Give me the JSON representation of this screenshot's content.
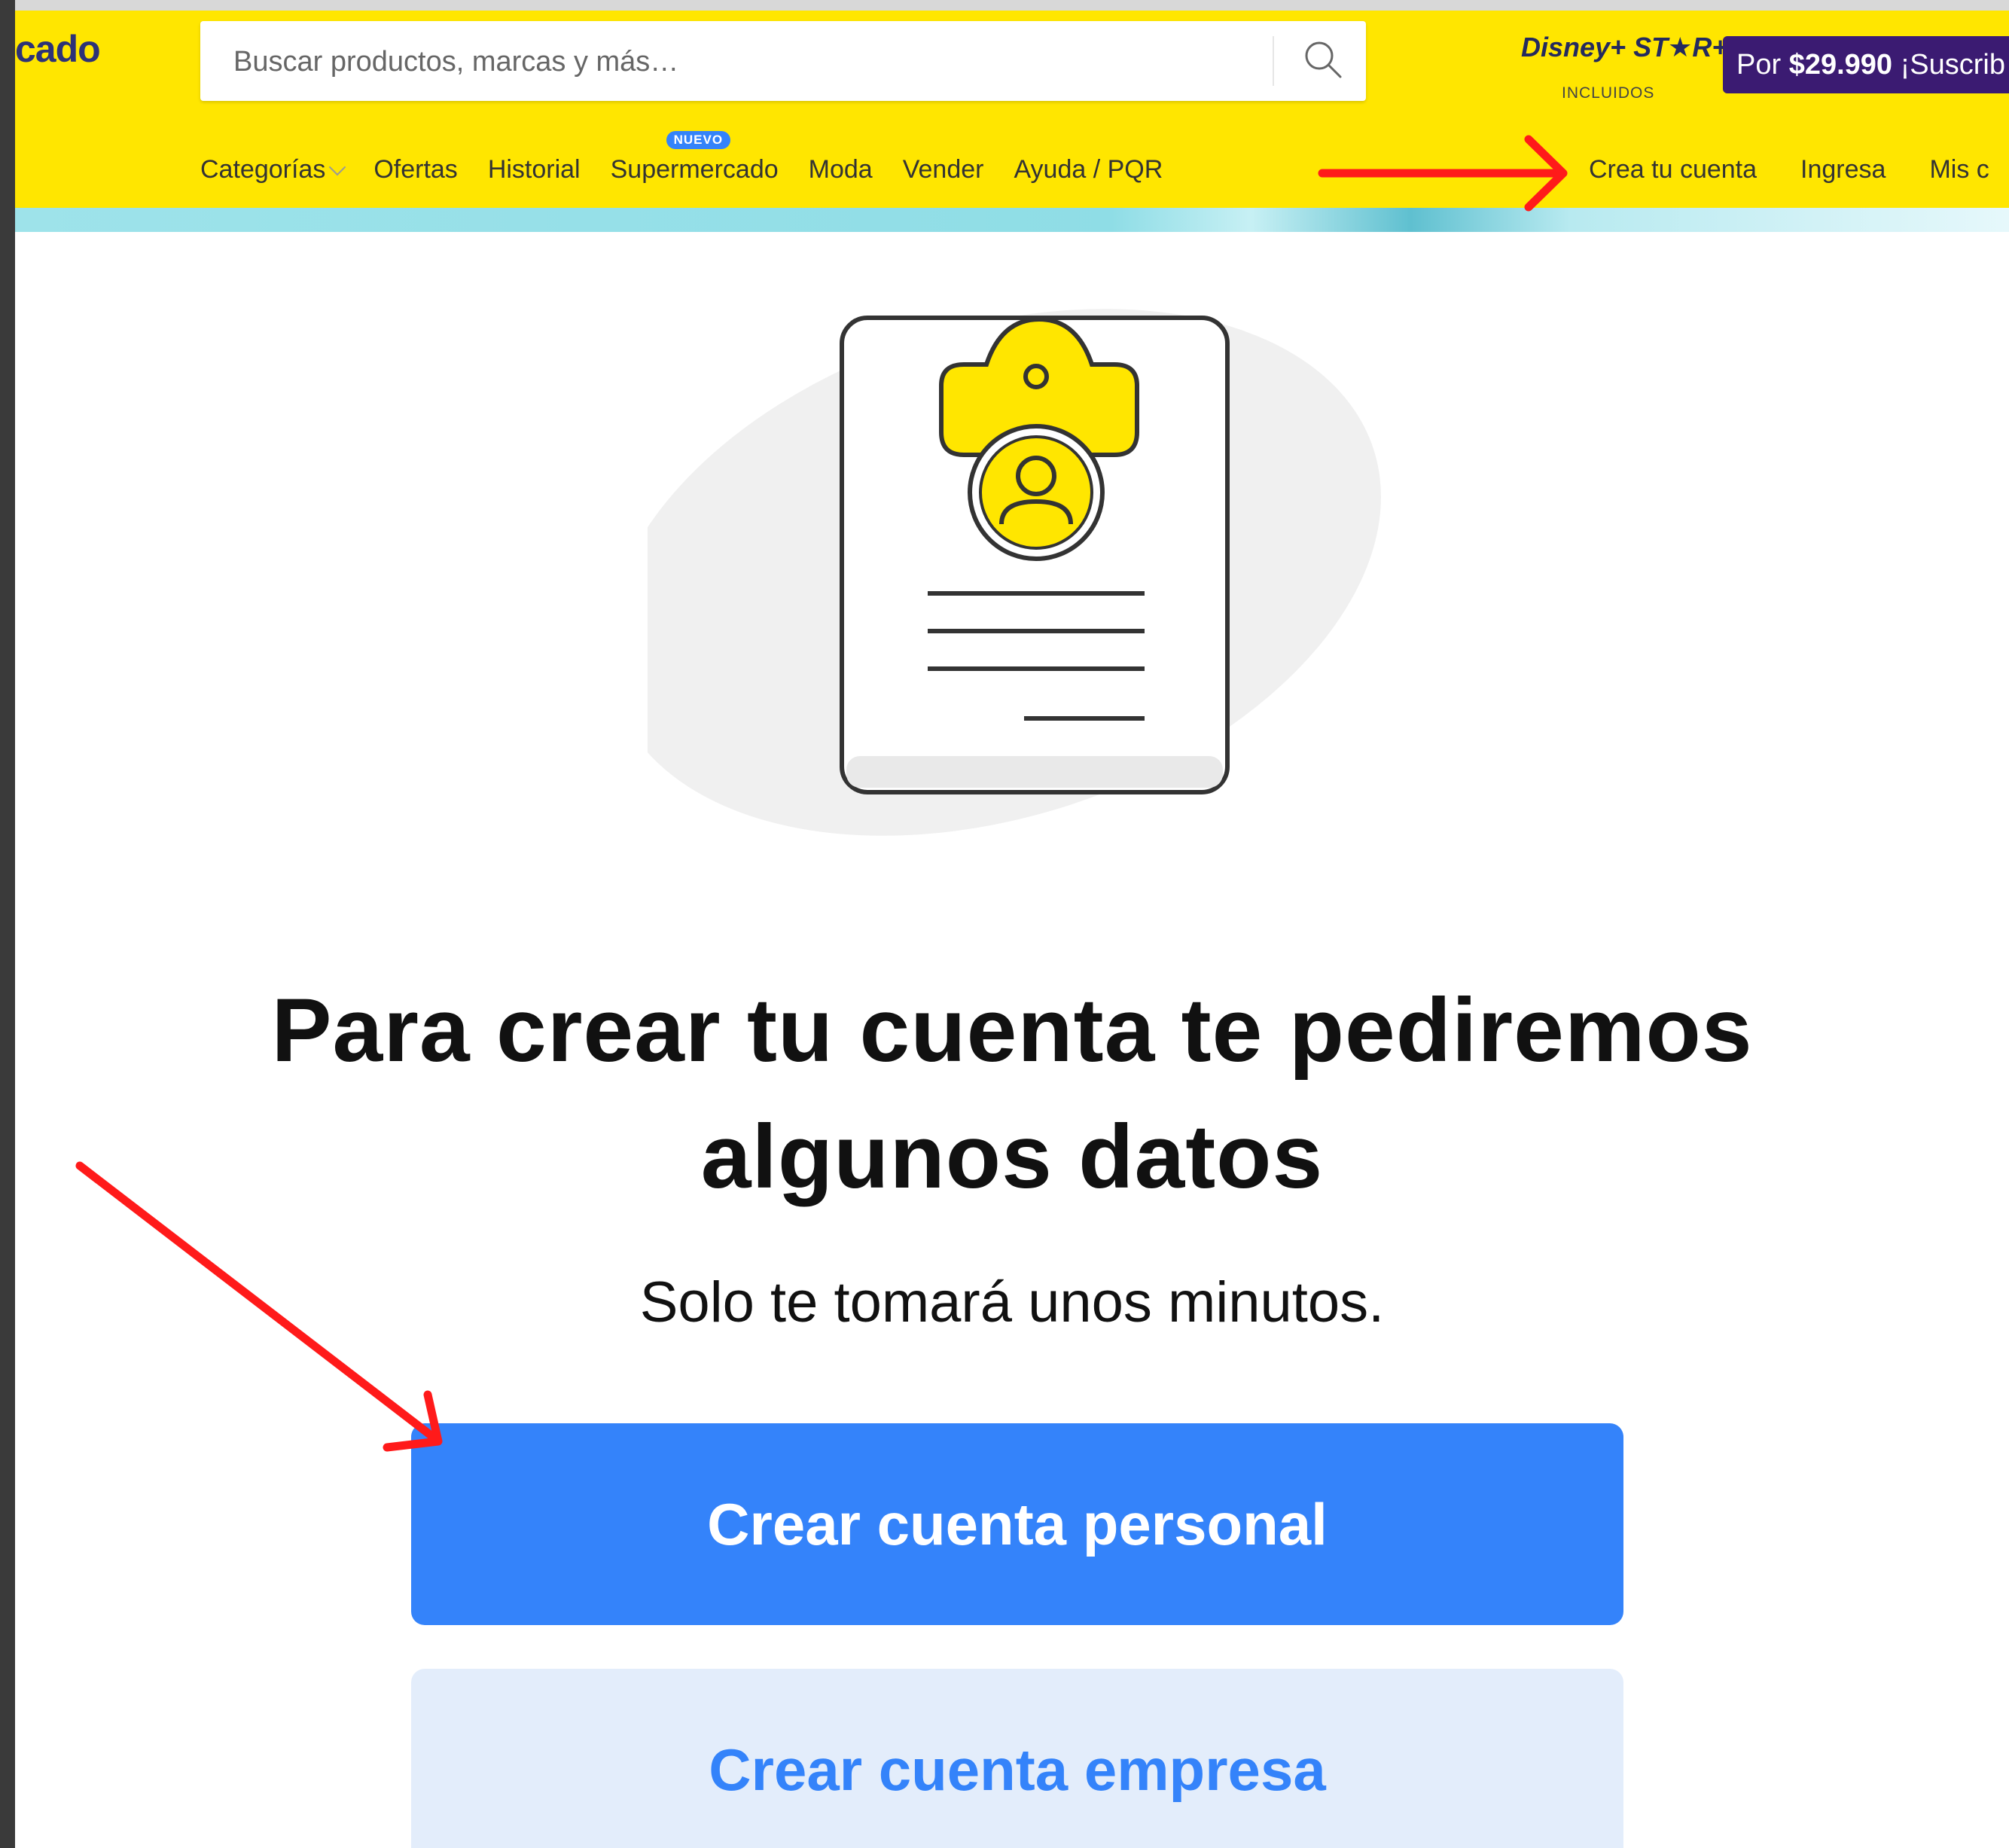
{
  "header": {
    "logo_text": "cado",
    "search": {
      "placeholder": "Buscar productos, marcas y más…",
      "value": ""
    },
    "promo": {
      "brand_text": "Disney+ ST★R+",
      "brand_sub": "INCLUIDOS",
      "price_prefix": "Por",
      "price": "$29.990",
      "cta": "¡Suscrib"
    },
    "nav": {
      "items": [
        {
          "label": "Categorías"
        },
        {
          "label": "Ofertas"
        },
        {
          "label": "Historial"
        },
        {
          "label": "Supermercado",
          "badge": "NUEVO"
        },
        {
          "label": "Moda"
        },
        {
          "label": "Vender"
        },
        {
          "label": "Ayuda / PQR"
        }
      ],
      "right": [
        {
          "label": "Crea tu cuenta"
        },
        {
          "label": "Ingresa"
        },
        {
          "label": "Mis c"
        }
      ]
    }
  },
  "main": {
    "headline_line1": "Para crear tu cuenta te pediremos",
    "headline_line2": "algunos datos",
    "subtitle": "Solo te tomará unos minutos.",
    "primary_button": "Crear cuenta personal",
    "secondary_button": "Crear cuenta empresa"
  },
  "colors": {
    "header_yellow": "#ffe600",
    "primary_blue": "#3483fa",
    "secondary_bg": "#e3edfb",
    "promo_purple": "#3b1b72",
    "annotation_red": "#ff1a1a"
  },
  "icons": [
    "search-icon",
    "chevron-down-icon",
    "clipboard-user-icon",
    "red-arrow-annotation"
  ]
}
